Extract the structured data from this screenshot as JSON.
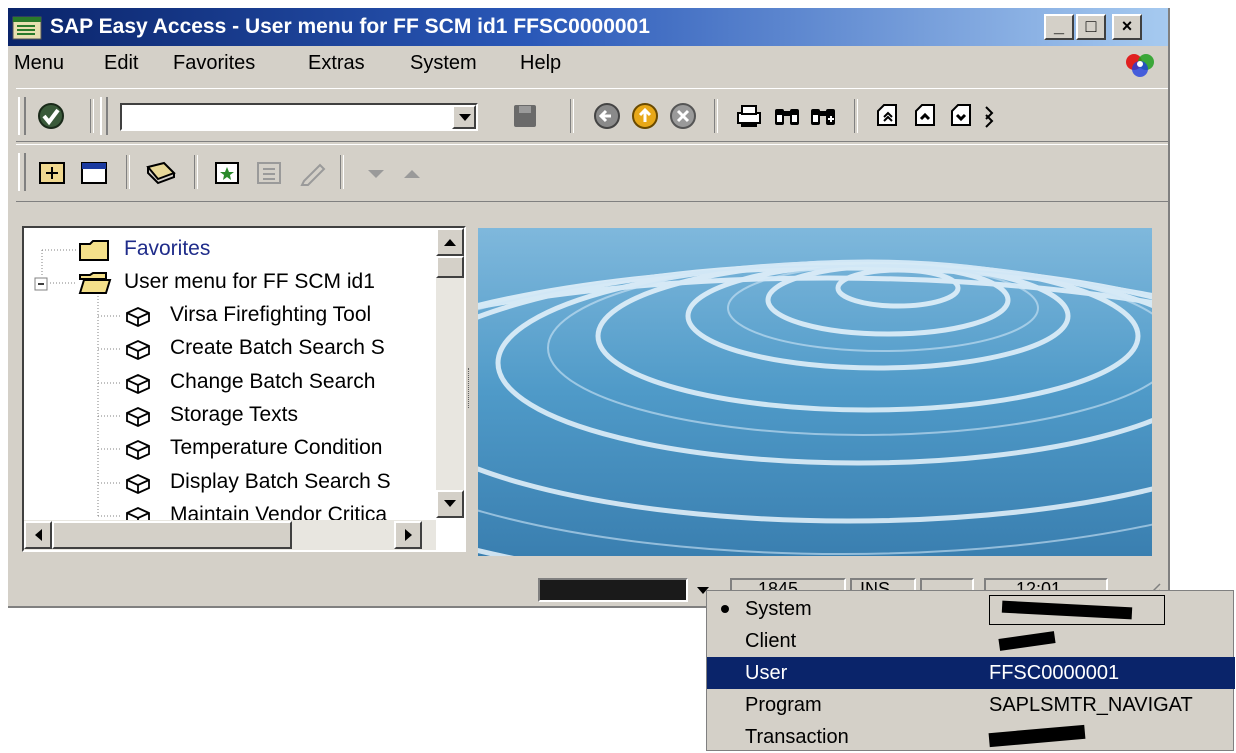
{
  "window": {
    "title": "SAP Easy Access  -  User menu for FF SCM id1 FFSC0000001",
    "controls": {
      "minimize": "_",
      "maximize": "□",
      "close": "×"
    }
  },
  "menubar": {
    "items": [
      "Menu",
      "Edit",
      "Favorites",
      "Extras",
      "System",
      "Help"
    ]
  },
  "toolbar": {
    "command_field_value": "",
    "icons": [
      "enter-icon",
      "save-icon",
      "back-icon",
      "exit-icon",
      "cancel-icon",
      "print-icon",
      "find-icon",
      "find-next-icon",
      "first-page-icon",
      "prev-page-icon",
      "next-page-icon",
      "last-page-icon"
    ]
  },
  "app_toolbar": {
    "icons": [
      "open-folder-icon",
      "user-menu-icon",
      "sap-menu-icon",
      "add-favorite-icon",
      "delete-favorite-icon",
      "change-favorite-icon",
      "move-down-icon",
      "move-up-icon"
    ]
  },
  "tree": {
    "favorites_label": "Favorites",
    "user_menu_label": "User menu for FF SCM id1",
    "items": [
      "Virsa Firefighting Tool",
      "Create Batch Search S",
      "Change Batch Search",
      "Storage Texts",
      "Temperature Condition",
      "Display Batch Search S",
      "Maintain Vendor Critica"
    ]
  },
  "status_bar": {
    "transaction_field": "",
    "server_field": "1845",
    "mode_field": "INS",
    "time_field": "12:01"
  },
  "system_popup": {
    "rows": [
      {
        "key": "System",
        "value": "",
        "redacted": true,
        "selected": false,
        "bullet": true
      },
      {
        "key": "Client",
        "value": "",
        "redacted": true,
        "selected": false,
        "bullet": false
      },
      {
        "key": "User",
        "value": "FFSC0000001",
        "redacted": false,
        "selected": true,
        "bullet": false
      },
      {
        "key": "Program",
        "value": "SAPLSMTR_NAVIGAT",
        "redacted": false,
        "selected": false,
        "bullet": false
      },
      {
        "key": "Transaction",
        "value": "",
        "redacted": true,
        "selected": false,
        "bullet": false
      }
    ]
  },
  "colors": {
    "title_bar_start": "#0a246a",
    "title_bar_end": "#a6caf0",
    "window_face": "#d4d0c8",
    "selection": "#0a246a",
    "tree_text_favorites": "#1f2c8a"
  }
}
